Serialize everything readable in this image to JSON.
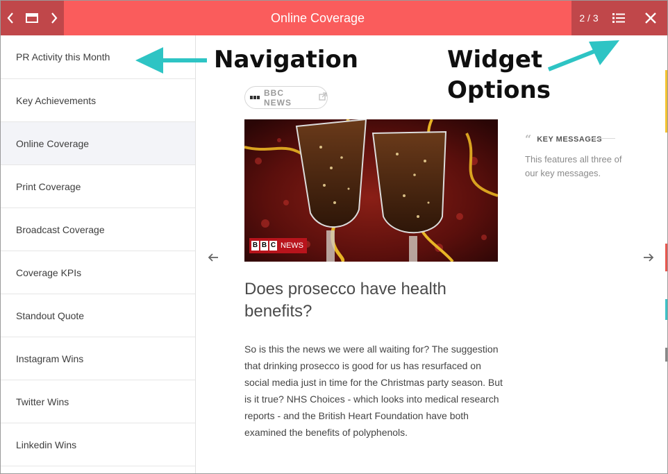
{
  "header": {
    "title": "Online Coverage",
    "pager": "2 / 3"
  },
  "icons": {
    "back": "chevron-left-icon",
    "window": "window-icon",
    "forward": "chevron-right-icon",
    "list": "list-icon",
    "close": "close-icon"
  },
  "colors": {
    "topbar": "#fa5c5c",
    "topbar_dark": "#c0474a",
    "annotation_arrow": "#2ec4c4",
    "active_item": "#f3f4f8"
  },
  "sidebar": {
    "items": [
      {
        "label": "PR Activity this Month"
      },
      {
        "label": "Key Achievements"
      },
      {
        "label": "Online Coverage",
        "active": true
      },
      {
        "label": "Print Coverage"
      },
      {
        "label": "Broadcast Coverage"
      },
      {
        "label": "Coverage KPIs"
      },
      {
        "label": "Standout Quote"
      },
      {
        "label": "Instagram Wins"
      },
      {
        "label": "Twitter Wins"
      },
      {
        "label": "Linkedin Wins"
      }
    ]
  },
  "article": {
    "source": "BBC NEWS",
    "logo_letters": [
      "B",
      "B",
      "C"
    ],
    "logo_word": "NEWS",
    "headline": "Does prosecco have health benefits?",
    "body": "So is this the news we were all waiting for? The suggestion that drinking prosecco is good for us has resurfaced on social media just in time for the Christmas party season. But is it true? NHS Choices - which looks into medical research reports - and the British Heart Foundation have both examined the benefits of polyphenols."
  },
  "key_messages": {
    "title": "KEY MESSAGES",
    "text": "This features all three of our key messages."
  },
  "annotations": {
    "navigation": "Navigation",
    "widget_line1": "Widget",
    "widget_line2": "Options"
  }
}
